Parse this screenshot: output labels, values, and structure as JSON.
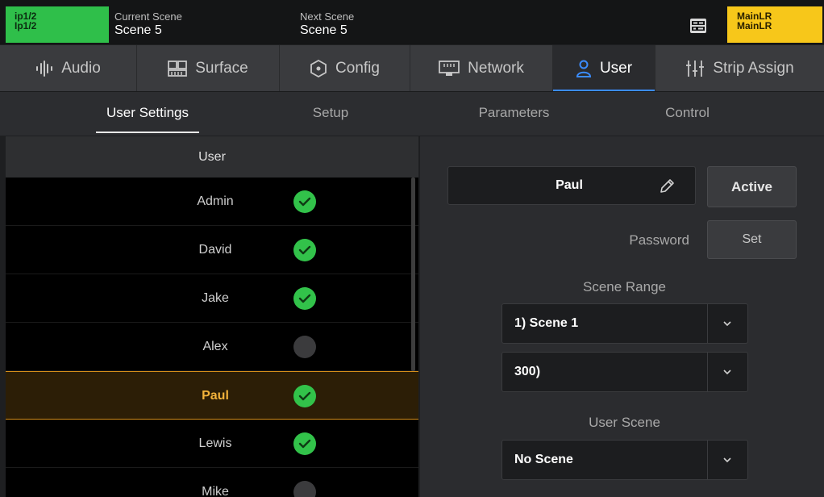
{
  "topbar": {
    "ip_line1": "ip1/2",
    "ip_line2": "Ip1/2",
    "current_scene_label": "Current Scene",
    "current_scene_value": "Scene 5",
    "next_scene_label": "Next Scene",
    "next_scene_value": "Scene 5",
    "main_line1": "MainLR",
    "main_line2": "MainLR",
    "colors": {
      "ip_box": "#2fbf4a",
      "main_box": "#f7c71a"
    }
  },
  "tabs": [
    {
      "label": "Audio",
      "icon": "audio-waveform-icon",
      "active": false
    },
    {
      "label": "Surface",
      "icon": "surface-icon",
      "active": false
    },
    {
      "label": "Config",
      "icon": "config-hexagon-icon",
      "active": false
    },
    {
      "label": "Network",
      "icon": "network-port-icon",
      "active": false
    },
    {
      "label": "User",
      "icon": "user-icon",
      "active": true
    },
    {
      "label": "Strip Assign",
      "icon": "fader-icon",
      "active": false
    }
  ],
  "subtabs": [
    {
      "label": "User Settings",
      "active": true
    },
    {
      "label": "Setup",
      "active": false
    },
    {
      "label": "Parameters",
      "active": false
    },
    {
      "label": "Control",
      "active": false
    }
  ],
  "user_list": {
    "header": "User",
    "rows": [
      {
        "name": "Admin",
        "active": true,
        "selected": false
      },
      {
        "name": "David",
        "active": true,
        "selected": false
      },
      {
        "name": "Jake",
        "active": true,
        "selected": false
      },
      {
        "name": "Alex",
        "active": false,
        "selected": false
      },
      {
        "name": "Paul",
        "active": true,
        "selected": true
      },
      {
        "name": "Lewis",
        "active": true,
        "selected": false
      },
      {
        "name": "Mike",
        "active": false,
        "selected": false
      }
    ]
  },
  "detail": {
    "user_name": "Paul",
    "active_button": "Active",
    "password_label": "Password",
    "set_button": "Set",
    "scene_range_label": "Scene Range",
    "scene_range_start": "1) Scene 1",
    "scene_range_end": "300)",
    "user_scene_label": "User Scene",
    "user_scene_value": "No Scene"
  },
  "accent_color": "#3b8cff",
  "selection_color": "#d68f1a"
}
